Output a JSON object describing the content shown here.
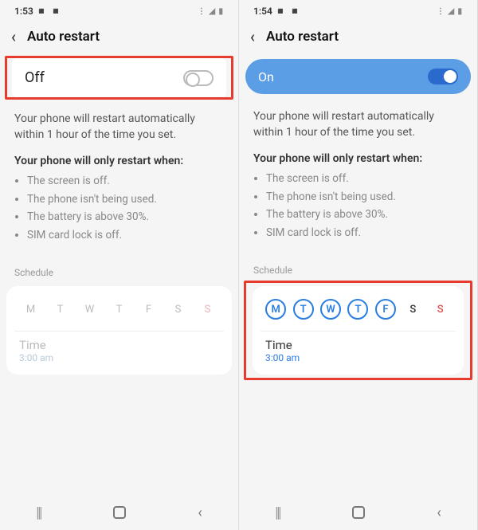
{
  "left": {
    "status_time": "1:53",
    "status_icons_left": "◾ ◾",
    "status_icons_right": "⋮ ◢ ▮",
    "header_title": "Auto restart",
    "toggle_label": "Off",
    "description": "Your phone will restart automatically within 1 hour of the time you set.",
    "conditions_title": "Your phone will only restart when:",
    "conditions": [
      "The screen is off.",
      "The phone isn't being used.",
      "The battery is above 30%.",
      "SIM card lock is off."
    ],
    "schedule_label": "Schedule",
    "days": [
      "M",
      "T",
      "W",
      "T",
      "F",
      "S",
      "S"
    ],
    "time_label": "Time",
    "time_value": "3:00 am"
  },
  "right": {
    "status_time": "1:54",
    "status_icons_left": "◾ ◾",
    "status_icons_right": "⋮ ◢ ▮",
    "header_title": "Auto restart",
    "toggle_label": "On",
    "description": "Your phone will restart automatically within 1 hour of the time you set.",
    "conditions_title": "Your phone will only restart when:",
    "conditions": [
      "The screen is off.",
      "The phone isn't being used.",
      "The battery is above 30%.",
      "SIM card lock is off."
    ],
    "schedule_label": "Schedule",
    "days": [
      "M",
      "T",
      "W",
      "T",
      "F",
      "S",
      "S"
    ],
    "time_label": "Time",
    "time_value": "3:00 am"
  },
  "highlight_color": "#e63b2e"
}
